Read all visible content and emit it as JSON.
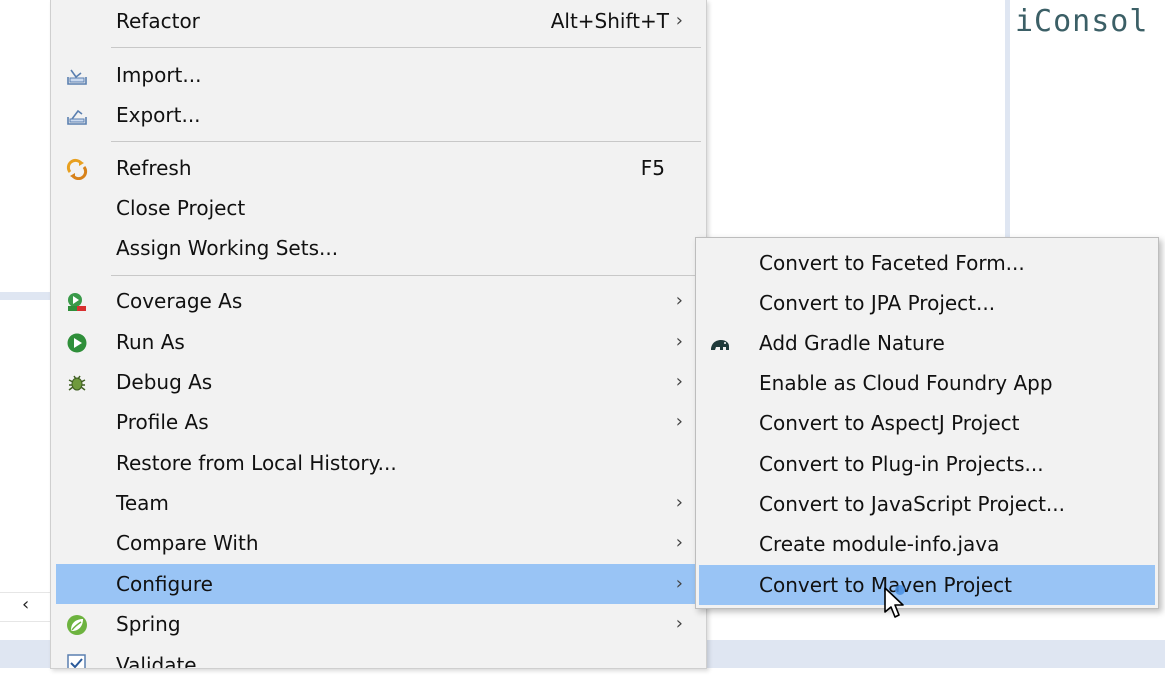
{
  "editor": {
    "code_fragment": "iConsol"
  },
  "menu": {
    "items": [
      {
        "label": "Refactor",
        "shortcut": "Alt+Shift+T",
        "submenu": true
      },
      {
        "label": "Import...",
        "icon": "import-icon"
      },
      {
        "label": "Export...",
        "icon": "export-icon"
      },
      {
        "label": "Refresh",
        "shortcut": "F5",
        "icon": "refresh-icon"
      },
      {
        "label": "Close Project"
      },
      {
        "label": "Assign Working Sets..."
      },
      {
        "label": "Coverage As",
        "submenu": true,
        "icon": "coverage-icon"
      },
      {
        "label": "Run As",
        "submenu": true,
        "icon": "run-icon"
      },
      {
        "label": "Debug As",
        "submenu": true,
        "icon": "debug-bug-icon"
      },
      {
        "label": "Profile As",
        "submenu": true
      },
      {
        "label": "Restore from Local History..."
      },
      {
        "label": "Team",
        "submenu": true
      },
      {
        "label": "Compare With",
        "submenu": true
      },
      {
        "label": "Configure",
        "submenu": true,
        "highlighted": true
      },
      {
        "label": "Spring",
        "submenu": true,
        "icon": "spring-leaf-icon"
      },
      {
        "label": "Validate",
        "icon": "checkbox-icon"
      }
    ]
  },
  "submenu": {
    "items": [
      {
        "label": "Convert to Faceted Form..."
      },
      {
        "label": "Convert to JPA Project..."
      },
      {
        "label": "Add Gradle Nature",
        "icon": "gradle-elephant-icon"
      },
      {
        "label": "Enable as Cloud Foundry App"
      },
      {
        "label": "Convert to AspectJ Project"
      },
      {
        "label": "Convert to Plug-in Projects..."
      },
      {
        "label": "Convert to JavaScript Project..."
      },
      {
        "label": "Create module-info.java"
      },
      {
        "label": "Convert to Maven Project",
        "highlighted": true
      }
    ]
  },
  "scroll": {
    "left_arrow": "‹"
  },
  "colors": {
    "highlight": "#99c4f5",
    "menu_bg": "#f2f2f2",
    "run_green": "#2f8f3a"
  }
}
